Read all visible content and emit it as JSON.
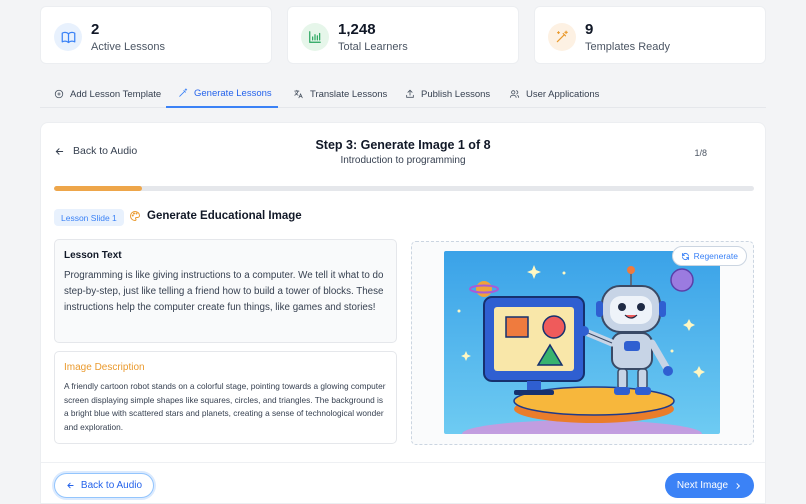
{
  "stats": [
    {
      "value": "2",
      "label": "Active Lessons",
      "icon": "book-icon",
      "icon_bg": "#e8f1fd",
      "icon_color": "#3b82f6"
    },
    {
      "value": "1,248",
      "label": "Total Learners",
      "icon": "bar-chart-icon",
      "icon_bg": "#e6f6ea",
      "icon_color": "#22a35a"
    },
    {
      "value": "9",
      "label": "Templates Ready",
      "icon": "magic-wand-icon",
      "icon_bg": "#fdf1e3",
      "icon_color": "#ea9a2e"
    }
  ],
  "tabs": [
    {
      "label": "Add Lesson Template",
      "icon": "plus-circle-icon",
      "active": false
    },
    {
      "label": "Generate Lessons",
      "icon": "magic-wand-icon",
      "active": true
    },
    {
      "label": "Translate Lessons",
      "icon": "translate-icon",
      "active": false
    },
    {
      "label": "Publish Lessons",
      "icon": "upload-icon",
      "active": false
    },
    {
      "label": "User Applications",
      "icon": "users-icon",
      "active": false
    }
  ],
  "step": {
    "back_label": "Back to Audio",
    "title": "Step 3: Generate Image 1 of 8",
    "subtitle": "Introduction to programming",
    "counter": "1/8",
    "progress": 0.125
  },
  "slide": {
    "badge": "Lesson Slide 1",
    "heading": "Generate Educational Image"
  },
  "lesson_text": {
    "title": "Lesson Text",
    "body": "Programming is like giving instructions to a computer. We tell it what to do step-by-step, just like telling a friend how to build a tower of blocks. These instructions help the computer create fun things, like games and stories!"
  },
  "image_description": {
    "title": "Image Description",
    "body": "A friendly cartoon robot stands on a colorful stage, pointing towards a glowing computer screen displaying simple shapes like squares, circles, and triangles. The background is a bright blue with scattered stars and planets, creating a sense of technological wonder and exploration."
  },
  "image": {
    "regenerate_label": "Regenerate"
  },
  "footer": {
    "back_label": "Back to Audio",
    "next_label": "Next Image"
  },
  "colors": {
    "accent": "#3b82f6",
    "progress": "#eea64a",
    "description_title": "#ea9a2e"
  }
}
